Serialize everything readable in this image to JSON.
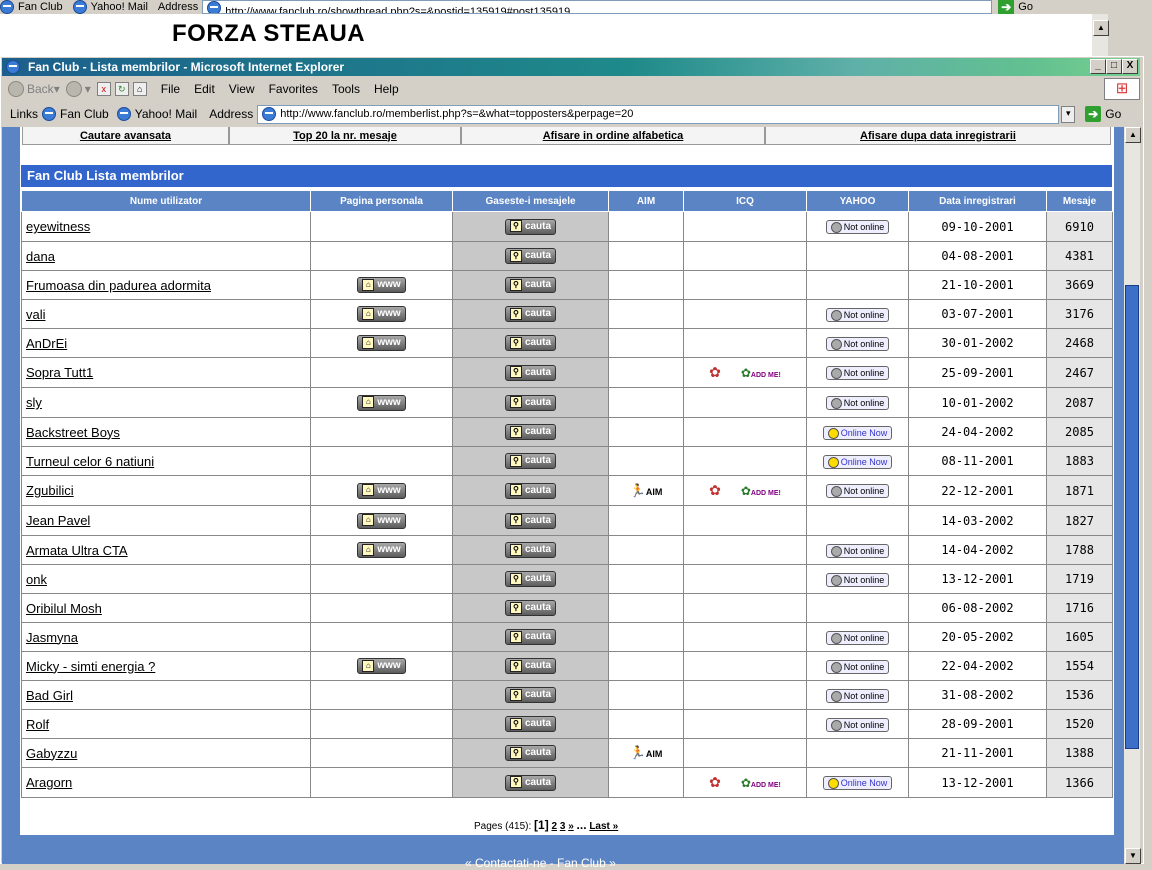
{
  "background_window": {
    "links": [
      "Fan Club",
      "Yahoo! Mail"
    ],
    "address_label": "Address",
    "address_url": "http://www.fanclub.ro/showthread.php?s=&postid=135919#post135919",
    "go_label": "Go",
    "page_heading": "FORZA STEAUA"
  },
  "window": {
    "title": "Fan Club - Lista membrilor - Microsoft Internet Explorer",
    "controls": [
      "_",
      "□",
      "X"
    ]
  },
  "toolbar": {
    "back_label": "Back",
    "menu": [
      "File",
      "Edit",
      "View",
      "Favorites",
      "Tools",
      "Help"
    ]
  },
  "addressbar": {
    "links_label": "Links",
    "links": [
      "Fan Club",
      "Yahoo! Mail"
    ],
    "address_label": "Address",
    "url": "http://www.fanclub.ro/memberlist.php?s=&what=topposters&perpage=20",
    "go_label": "Go"
  },
  "nav_links": [
    "Cautare avansata",
    "Top 20 la nr. mesaje",
    "Afisare in ordine alfabetica",
    "Afisare dupa data inregistrarii"
  ],
  "table": {
    "title": "Fan Club Lista membrilor",
    "headers": [
      "Nume utilizator",
      "Pagina personala",
      "Gaseste-i mesajele",
      "AIM",
      "ICQ",
      "YAHOO",
      "Data inregistrari",
      "Mesaje"
    ],
    "www_label": "www",
    "search_label": "cauta",
    "aim_label": "AIM",
    "icq_add_label": "ADD ME!",
    "not_online_label": "Not online",
    "online_label": "Online Now",
    "rows": [
      {
        "name": "eyewitness",
        "www": false,
        "aim": false,
        "icq": false,
        "yahoo": "off",
        "date": "09-10-2001",
        "posts": "6910"
      },
      {
        "name": "dana",
        "www": false,
        "aim": false,
        "icq": false,
        "yahoo": "",
        "date": "04-08-2001",
        "posts": "4381"
      },
      {
        "name": "Frumoasa din padurea adormita",
        "www": true,
        "aim": false,
        "icq": false,
        "yahoo": "",
        "date": "21-10-2001",
        "posts": "3669"
      },
      {
        "name": "vali",
        "www": true,
        "aim": false,
        "icq": false,
        "yahoo": "off",
        "date": "03-07-2001",
        "posts": "3176"
      },
      {
        "name": "AnDrEi",
        "www": true,
        "aim": false,
        "icq": false,
        "yahoo": "off",
        "date": "30-01-2002",
        "posts": "2468"
      },
      {
        "name": "Sopra Tutt1",
        "www": false,
        "aim": false,
        "icq": true,
        "yahoo": "off",
        "date": "25-09-2001",
        "posts": "2467"
      },
      {
        "name": "sly",
        "www": true,
        "aim": false,
        "icq": false,
        "yahoo": "off",
        "date": "10-01-2002",
        "posts": "2087"
      },
      {
        "name": "Backstreet Boys",
        "www": false,
        "aim": false,
        "icq": false,
        "yahoo": "on",
        "date": "24-04-2002",
        "posts": "2085"
      },
      {
        "name": "Turneul celor 6 natiuni",
        "www": false,
        "aim": false,
        "icq": false,
        "yahoo": "on",
        "date": "08-11-2001",
        "posts": "1883"
      },
      {
        "name": "Zgubilici",
        "www": true,
        "aim": true,
        "icq": true,
        "yahoo": "off",
        "date": "22-12-2001",
        "posts": "1871"
      },
      {
        "name": "Jean Pavel",
        "www": true,
        "aim": false,
        "icq": false,
        "yahoo": "",
        "date": "14-03-2002",
        "posts": "1827"
      },
      {
        "name": "Armata Ultra CTA",
        "www": true,
        "aim": false,
        "icq": false,
        "yahoo": "off",
        "date": "14-04-2002",
        "posts": "1788"
      },
      {
        "name": "onk",
        "www": false,
        "aim": false,
        "icq": false,
        "yahoo": "off",
        "date": "13-12-2001",
        "posts": "1719"
      },
      {
        "name": "Oribilul Mosh",
        "www": false,
        "aim": false,
        "icq": false,
        "yahoo": "",
        "date": "06-08-2002",
        "posts": "1716"
      },
      {
        "name": "Jasmyna",
        "www": false,
        "aim": false,
        "icq": false,
        "yahoo": "off",
        "date": "20-05-2002",
        "posts": "1605"
      },
      {
        "name": "Micky - simti energia ?",
        "www": true,
        "aim": false,
        "icq": false,
        "yahoo": "off",
        "date": "22-04-2002",
        "posts": "1554"
      },
      {
        "name": "Bad Girl",
        "www": false,
        "aim": false,
        "icq": false,
        "yahoo": "off",
        "date": "31-08-2002",
        "posts": "1536"
      },
      {
        "name": "Rolf",
        "www": false,
        "aim": false,
        "icq": false,
        "yahoo": "off",
        "date": "28-09-2001",
        "posts": "1520"
      },
      {
        "name": "Gabyzzu",
        "www": false,
        "aim": true,
        "icq": false,
        "yahoo": "",
        "date": "21-11-2001",
        "posts": "1388"
      },
      {
        "name": "Aragorn",
        "www": false,
        "aim": false,
        "icq": true,
        "yahoo": "on",
        "date": "13-12-2001",
        "posts": "1366"
      }
    ]
  },
  "pager": {
    "label": "Pages (415):",
    "current": "[1]",
    "pages": [
      "2",
      "3"
    ],
    "next": "»",
    "ellipsis": "...",
    "last": "Last »"
  },
  "footer_partial": "« Contactati-ne - Fan Club »",
  "colors": {
    "header_blue": "#3366cc",
    "column_header": "#5b84c4",
    "page_bg": "#5b84c4"
  }
}
